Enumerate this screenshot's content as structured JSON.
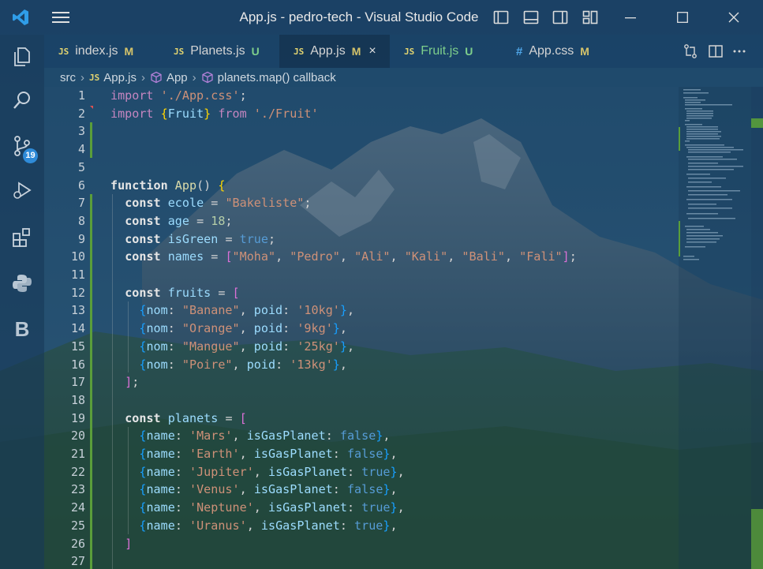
{
  "window": {
    "title": "App.js - pedro-tech - Visual Studio Code"
  },
  "activity_bar": {
    "items": [
      {
        "name": "explorer",
        "icon": "files-icon"
      },
      {
        "name": "search",
        "icon": "search-icon"
      },
      {
        "name": "source-control",
        "icon": "source-control-icon",
        "badge": "19"
      },
      {
        "name": "run-debug",
        "icon": "debug-icon"
      },
      {
        "name": "extensions",
        "icon": "extensions-icon"
      },
      {
        "name": "python",
        "icon": "python-icon"
      },
      {
        "name": "b-extension",
        "icon": "b-letter-icon",
        "label": "B"
      }
    ]
  },
  "tabs": [
    {
      "icon": "JS",
      "label": "index.js",
      "status": "M",
      "active": false
    },
    {
      "icon": "JS",
      "label": "Planets.js",
      "status": "U",
      "active": false
    },
    {
      "icon": "JS",
      "label": "App.js",
      "status": "M",
      "active": true,
      "close": "×"
    },
    {
      "icon": "JS",
      "label": "Fruit.js",
      "status": "U",
      "active": false
    },
    {
      "icon": "#",
      "label": "App.css",
      "status": "M",
      "active": false
    }
  ],
  "breadcrumb": {
    "folder": "src",
    "file_icon": "JS",
    "file": "App.js",
    "symbol1": "App",
    "symbol2": "planets.map() callback",
    "separator": "›"
  },
  "editor": {
    "line_numbers": [
      "1",
      "2",
      "3",
      "4",
      "5",
      "6",
      "7",
      "8",
      "9",
      "10",
      "11",
      "12",
      "13",
      "14",
      "15",
      "16",
      "17",
      "18",
      "19",
      "20",
      "21",
      "22",
      "23",
      "24",
      "25",
      "26",
      "27"
    ],
    "code": {
      "l1": {
        "import": "import",
        "path": "'./App.css'",
        "semi": ";"
      },
      "l2": {
        "import": "import",
        "lb": "{",
        "name": "Fruit",
        "rb": "}",
        "from": "from",
        "path": "'./Fruit'"
      },
      "l6": {
        "kw": "function",
        "name": "App",
        "paren": "()",
        "brace": "{"
      },
      "l7": {
        "kw": "const",
        "name": "ecole",
        "eq": "=",
        "val": "\"Bakeliste\"",
        "semi": ";"
      },
      "l8": {
        "kw": "const",
        "name": "age",
        "eq": "=",
        "val": "18",
        "semi": ";"
      },
      "l9": {
        "kw": "const",
        "name": "isGreen",
        "eq": "=",
        "val": "true",
        "semi": ";"
      },
      "l10": {
        "kw": "const",
        "name": "names",
        "eq": "=",
        "lb": "[",
        "items": [
          "\"Moha\"",
          "\"Pedro\"",
          "\"Ali\"",
          "\"Kali\"",
          "\"Bali\"",
          "\"Fali\""
        ],
        "rb": "]",
        "semi": ";"
      },
      "l12": {
        "kw": "const",
        "name": "fruits",
        "eq": "=",
        "lb": "["
      },
      "fruits": [
        {
          "k1": "nom",
          "v1": "\"Banane\"",
          "k2": "poid",
          "v2": "'10kg'"
        },
        {
          "k1": "nom",
          "v1": "\"Orange\"",
          "k2": "poid",
          "v2": "'9kg'"
        },
        {
          "k1": "nom",
          "v1": "\"Mangue\"",
          "k2": "poid",
          "v2": "'25kg'"
        },
        {
          "k1": "nom",
          "v1": "\"Poire\"",
          "k2": "poid",
          "v2": "'13kg'"
        }
      ],
      "l17": {
        "rb": "]",
        "semi": ";"
      },
      "l19": {
        "kw": "const",
        "name": "planets",
        "eq": "=",
        "lb": "["
      },
      "planets": [
        {
          "k1": "name",
          "v1": "'Mars'",
          "k2": "isGasPlanet",
          "v2": "false"
        },
        {
          "k1": "name",
          "v1": "'Earth'",
          "k2": "isGasPlanet",
          "v2": "false"
        },
        {
          "k1": "name",
          "v1": "'Jupiter'",
          "k2": "isGasPlanet",
          "v2": "true"
        },
        {
          "k1": "name",
          "v1": "'Venus'",
          "k2": "isGasPlanet",
          "v2": "false"
        },
        {
          "k1": "name",
          "v1": "'Neptune'",
          "k2": "isGasPlanet",
          "v2": "true"
        },
        {
          "k1": "name",
          "v1": "'Uranus'",
          "k2": "isGasPlanet",
          "v2": "true"
        }
      ],
      "l26": {
        "rb": "]"
      }
    }
  },
  "colors": {
    "titlebar": "#183c60",
    "accent": "#2f8bd8",
    "git_added": "#5a9e3a",
    "keyword": "#c586c0",
    "string": "#ce9178",
    "variable": "#9cdcfe",
    "function": "#dcdcaa",
    "number": "#b5cea8",
    "boolean": "#569cd6"
  }
}
